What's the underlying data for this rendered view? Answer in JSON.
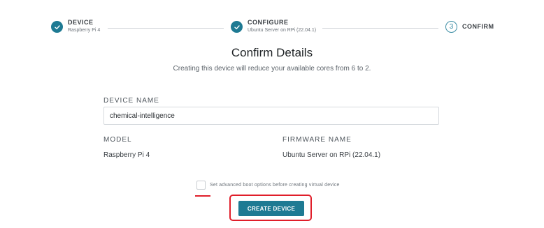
{
  "stepper": {
    "steps": [
      {
        "title": "DEVICE",
        "subtitle": "Raspberry Pi 4",
        "state": "done"
      },
      {
        "title": "CONFIGURE",
        "subtitle": "Ubuntu Server on RPi (22.04.1)",
        "state": "done"
      },
      {
        "title": "CONFIRM",
        "number": "3",
        "state": "current"
      }
    ]
  },
  "header": {
    "title": "Confirm Details",
    "subtitle": "Creating this device will reduce your available cores from 6 to 2."
  },
  "form": {
    "device_name_label": "DEVICE NAME",
    "device_name_value": "chemical-intelligence",
    "model_label": "MODEL",
    "model_value": "Raspberry Pi 4",
    "firmware_label": "FIRMWARE NAME",
    "firmware_value": "Ubuntu Server on RPi (22.04.1)",
    "advanced_boot_label": "Set advanced boot options before creating virtual device",
    "advanced_boot_checked": false
  },
  "actions": {
    "create_label": "CREATE DEVICE"
  },
  "colors": {
    "accent": "#1e7a93",
    "highlight": "#e01e2a"
  }
}
